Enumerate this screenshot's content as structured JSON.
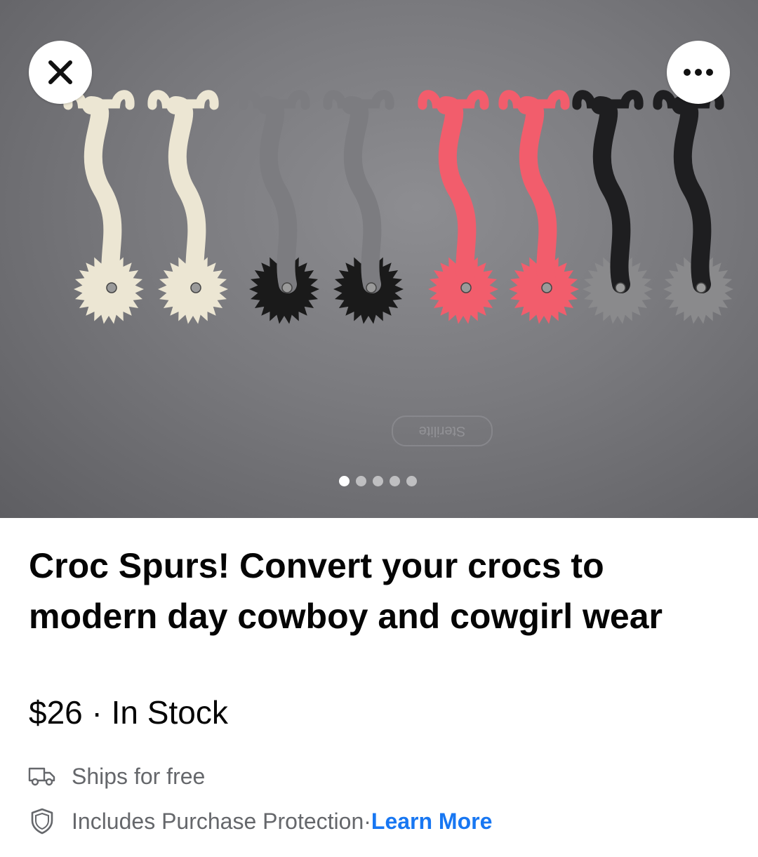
{
  "listing": {
    "title": "Croc Spurs! Convert your crocs to modern day cowboy and cowgirl wear",
    "price": "$26",
    "separator": " · ",
    "availability": "In Stock",
    "shipping": "Ships for free",
    "protection": "Includes Purchase Protection",
    "protection_separator": " · ",
    "learn_more": "Learn More"
  },
  "photo": {
    "pager": {
      "count": 5,
      "active_index": 0
    },
    "watermark": "Sterilite",
    "spur_colors": [
      "#ece6d3",
      "#ece6d3",
      "#7c7c80",
      "#7c7c80",
      "#f25d6c",
      "#f25d6c",
      "#1e1e20",
      "#1e1e20"
    ],
    "wheel_colors": [
      "#ece6d3",
      "#ece6d3",
      "#1a1a1a",
      "#1a1a1a",
      "#f25d6c",
      "#f25d6c",
      "#8a8a8c",
      "#8a8a8c"
    ]
  },
  "icons": {
    "close": "close-icon",
    "more": "more-icon",
    "shipping": "truck-icon",
    "protection": "shield-icon"
  },
  "colors": {
    "link": "#1877f2",
    "secondary_text": "#65676b",
    "primary_text": "#050505"
  }
}
